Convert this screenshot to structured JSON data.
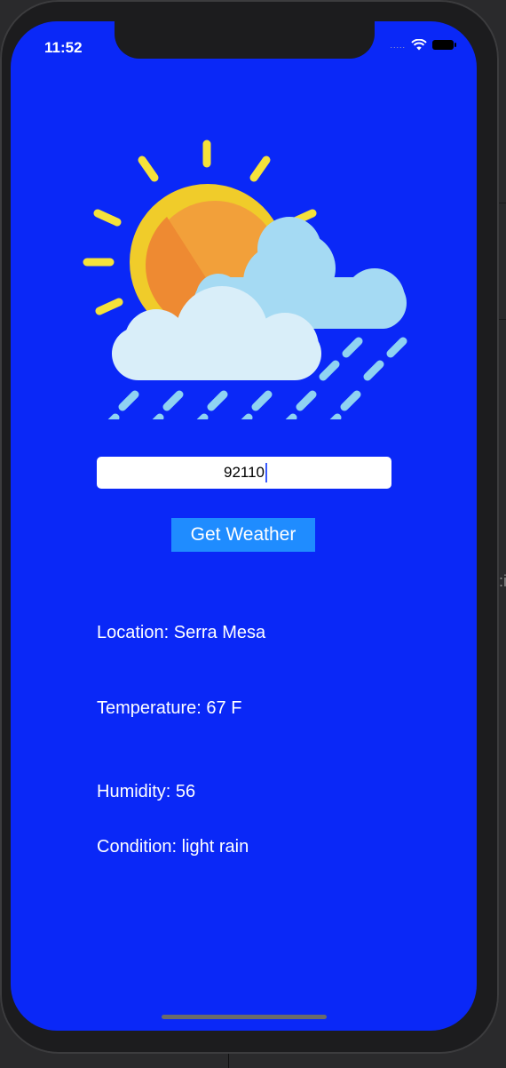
{
  "status_bar": {
    "time": "11:52",
    "signal": "....."
  },
  "search": {
    "zip_value": "92110"
  },
  "actions": {
    "get_weather_label": "Get Weather"
  },
  "weather": {
    "location": "Location: Serra Mesa",
    "temperature": "Temperature: 67 F",
    "humidity": "Humidity: 56",
    "condition": "Condition: light rain"
  },
  "icons": [
    "weather-rain-icon",
    "wifi-icon",
    "battery-icon"
  ],
  "colors": {
    "screen_bg": "#0a28f7",
    "button_bg": "#1f8cff"
  }
}
